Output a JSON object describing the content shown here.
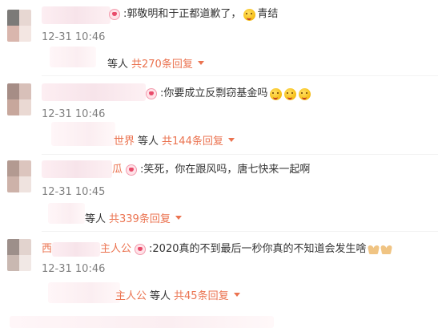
{
  "comments": [
    {
      "text": ":郭敬明和于正都道歉了，",
      "text_after_emoji": "青结",
      "timestamp": "12-31 10:46",
      "user_tail": "",
      "reply_prefix": "",
      "reply_people": "等人",
      "reply_count": "共270条回复"
    },
    {
      "text": ":你要成立反剽窃基金吗",
      "timestamp": "12-31 10:46",
      "user_tail": "",
      "reply_prefix": "世界",
      "reply_people": "等人",
      "reply_count": "共144条回复"
    },
    {
      "text": ":笑死，你在跟风吗，唐七快来一起啊",
      "timestamp": "12-31 10:45",
      "user_tail": "瓜",
      "reply_prefix": "",
      "reply_people": "等人",
      "reply_count": "共339条回复"
    },
    {
      "text": ":2020真的不到最后一秒你真的不知道会发生啥",
      "timestamp": "12-31 10:46",
      "user_tail": "主人公",
      "user_head": "西",
      "reply_prefix": "主人公",
      "reply_people": "等人",
      "reply_count": "共45条回复"
    }
  ],
  "colors": {
    "link": "#eb7350",
    "time": "#808080",
    "text": "#333333"
  },
  "icons": [
    "fan-badge-icon",
    "smile-emoji-icon",
    "pray-emoji-icon",
    "chevron-down-icon"
  ]
}
